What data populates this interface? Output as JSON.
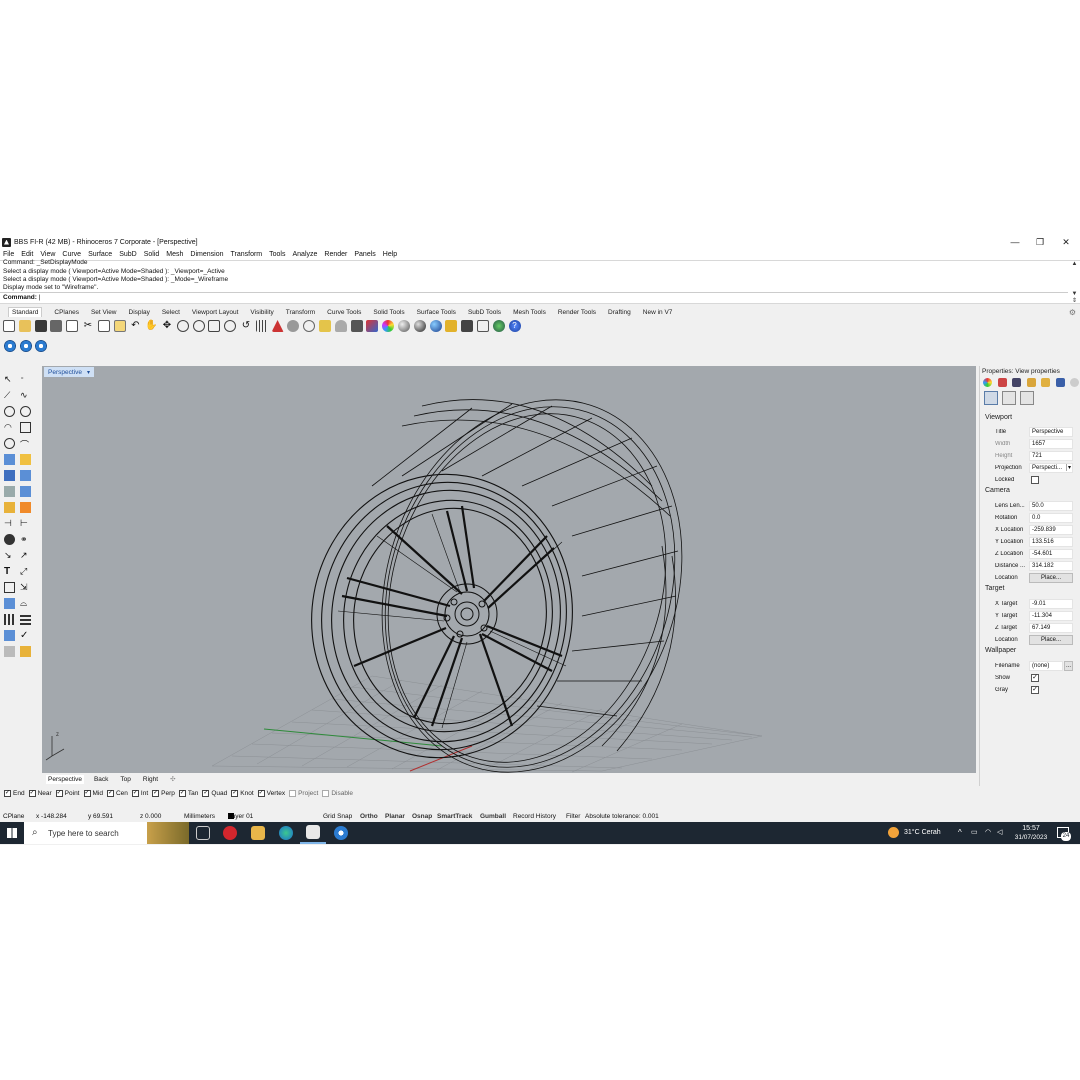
{
  "window": {
    "title": "BBS FI-R (42 MB) - Rhinoceros 7 Corporate - [Perspective]",
    "min_glyph": "—",
    "max_glyph": "❐",
    "close_glyph": "✕"
  },
  "menu": [
    "File",
    "Edit",
    "View",
    "Curve",
    "Surface",
    "SubD",
    "Solid",
    "Mesh",
    "Dimension",
    "Transform",
    "Tools",
    "Analyze",
    "Render",
    "Panels",
    "Help"
  ],
  "command_history": [
    "Command: _SetDisplayMode",
    "Select a display mode ( Viewport=Active  Mode=Shaded ): _Viewport=_Active",
    "Select a display mode ( Viewport=Active  Mode=Shaded ): _Mode=_Wireframe",
    "Display mode set to \"Wireframe\"."
  ],
  "command_prompt": "Command:",
  "toolbar_tabs": [
    "Standard",
    "CPlanes",
    "Set View",
    "Display",
    "Select",
    "Viewport Layout",
    "Visibility",
    "Transform",
    "Curve Tools",
    "Solid Tools",
    "Surface Tools",
    "SubD Tools",
    "Mesh Tools",
    "Render Tools",
    "Drafting",
    "New in V7"
  ],
  "active_toolbar_tab": "Standard",
  "viewport": {
    "title": "Perspective",
    "display_mode": "Wireframe",
    "bg_color": "#a3a8ad",
    "tabs": [
      "Perspective",
      "Back",
      "Top",
      "Right"
    ],
    "active_tab": "Perspective",
    "add_tab_glyph": "✣"
  },
  "properties": {
    "panel_title": "Properties: View properties",
    "viewport_section": "Viewport",
    "camera_section": "Camera",
    "target_section": "Target",
    "wallpaper_section": "Wallpaper",
    "title_label": "Title",
    "title": "Perspective",
    "width_label": "Width",
    "width": "1657",
    "height_label": "Height",
    "height": "721",
    "projection_label": "Projection",
    "projection": "Perspecti...",
    "locked_label": "Locked",
    "lens_label": "Lens Len...",
    "lens": "50.0",
    "rotation_label": "Rotation",
    "rotation": "0.0",
    "xloc_label": "X Location",
    "xloc": "-259.839",
    "yloc_label": "Y Location",
    "yloc": "133.516",
    "zloc_label": "Z Location",
    "zloc": "-54.601",
    "distance_label": "Distance ...",
    "distance": "314.182",
    "location_label": "Location",
    "place_button": "Place...",
    "xtarget_label": "X Target",
    "xtarget": "-9.01",
    "ytarget_label": "Y Target",
    "ytarget": "-11.304",
    "ztarget_label": "Z Target",
    "ztarget": "67.149",
    "filename_label": "Filename",
    "filename": "(none)",
    "browse_button": "...",
    "show_label": "Show",
    "gray_label": "Gray"
  },
  "osnaps": [
    {
      "label": "End",
      "checked": true
    },
    {
      "label": "Near",
      "checked": true
    },
    {
      "label": "Point",
      "checked": true
    },
    {
      "label": "Mid",
      "checked": true
    },
    {
      "label": "Cen",
      "checked": true
    },
    {
      "label": "Int",
      "checked": true
    },
    {
      "label": "Perp",
      "checked": true
    },
    {
      "label": "Tan",
      "checked": true
    },
    {
      "label": "Quad",
      "checked": true
    },
    {
      "label": "Knot",
      "checked": true
    },
    {
      "label": "Vertex",
      "checked": true
    },
    {
      "label": "Project",
      "checked": false
    },
    {
      "label": "Disable",
      "checked": false
    }
  ],
  "status": {
    "cplane": "CPlane",
    "x": "x -148.284",
    "y": "y 69.591",
    "z": "z 0.000",
    "units": "Millimeters",
    "layer": "Layer 01",
    "grid_snap": "Grid Snap",
    "ortho": "Ortho",
    "planar": "Planar",
    "osnap": "Osnap",
    "smarttrack": "SmartTrack",
    "gumball": "Gumball",
    "record_history": "Record History",
    "filter": "Filter",
    "tolerance": "Absolute tolerance: 0.001"
  },
  "taskbar": {
    "search_placeholder": "Type here to search",
    "weather": "31°C  Cerah",
    "time": "15:57",
    "date": "31/07/2023",
    "notification_count": "24"
  }
}
